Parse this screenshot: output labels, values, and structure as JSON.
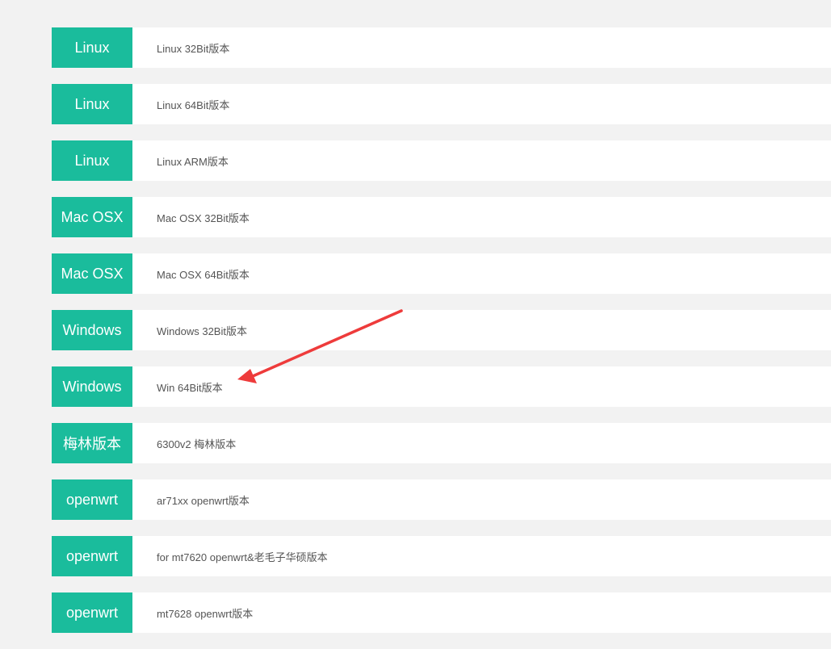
{
  "colors": {
    "page_background": "#f2f2f2",
    "tag_background": "#1abc9c",
    "tag_text": "#ffffff",
    "row_background": "#ffffff",
    "desc_text": "#555555",
    "annotation_arrow": "#ee3b3b"
  },
  "downloads": [
    {
      "platform": "Linux",
      "description": "Linux 32Bit版本"
    },
    {
      "platform": "Linux",
      "description": "Linux 64Bit版本"
    },
    {
      "platform": "Linux",
      "description": "Linux ARM版本"
    },
    {
      "platform": "Mac OSX",
      "description": "Mac OSX 32Bit版本"
    },
    {
      "platform": "Mac OSX",
      "description": "Mac OSX 64Bit版本"
    },
    {
      "platform": "Windows",
      "description": "Windows 32Bit版本"
    },
    {
      "platform": "Windows",
      "description": "Win 64Bit版本"
    },
    {
      "platform": "梅林版本",
      "description": "6300v2 梅林版本"
    },
    {
      "platform": "openwrt",
      "description": "ar71xx openwrt版本"
    },
    {
      "platform": "openwrt",
      "description": "for mt7620 openwrt&老毛子华硕版本"
    },
    {
      "platform": "openwrt",
      "description": "mt7628 openwrt版本"
    }
  ],
  "annotation": {
    "icon": "red-arrow-icon",
    "points_to_row": 6
  }
}
